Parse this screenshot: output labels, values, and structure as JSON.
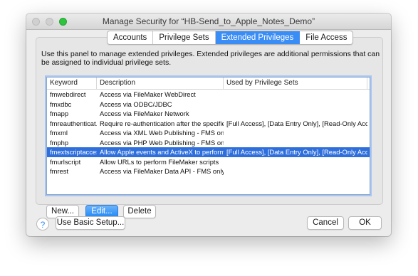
{
  "window": {
    "title": "Manage Security for “HB-Send_to_Apple_Notes_Demo”"
  },
  "tabs": [
    {
      "label": "Accounts",
      "active": false
    },
    {
      "label": "Privilege Sets",
      "active": false
    },
    {
      "label": "Extended Privileges",
      "active": true
    },
    {
      "label": "File Access",
      "active": false
    }
  ],
  "instructions": "Use this panel to manage extended privileges. Extended privileges are additional permissions that can be assigned to individual privilege sets.",
  "table": {
    "headers": [
      "Keyword",
      "Description",
      "Used by Privilege Sets"
    ],
    "rows": [
      {
        "keyword": "fmwebdirect",
        "description": "Access via FileMaker WebDirect",
        "used_by": ""
      },
      {
        "keyword": "fmxdbc",
        "description": "Access via ODBC/JDBC",
        "used_by": ""
      },
      {
        "keyword": "fmapp",
        "description": "Access via FileMaker Network",
        "used_by": ""
      },
      {
        "keyword": "fmreauthenticat...",
        "description": "Require re-authentication after the specified mi...",
        "used_by": "[Full Access], [Data Entry Only], [Read-Only Access]"
      },
      {
        "keyword": "fmxml",
        "description": "Access via XML Web Publishing - FMS only",
        "used_by": ""
      },
      {
        "keyword": "fmphp",
        "description": "Access via PHP Web Publishing - FMS only",
        "used_by": ""
      },
      {
        "keyword": "fmextscriptaccess",
        "description": "Allow Apple events and ActiveX to perform File...",
        "used_by": "[Full Access], [Data Entry Only], [Read-Only Access]",
        "selected": true
      },
      {
        "keyword": "fmurlscript",
        "description": "Allow URLs to perform FileMaker scripts",
        "used_by": ""
      },
      {
        "keyword": "fmrest",
        "description": "Access via FileMaker Data API - FMS only",
        "used_by": ""
      }
    ]
  },
  "buttons": {
    "new": "New...",
    "edit": "Edit...",
    "delete": "Delete",
    "basic_setup": "Use Basic Setup...",
    "cancel": "Cancel",
    "ok": "OK"
  },
  "help_icon": "?",
  "colors": {
    "accent": "#3b8df6",
    "selection": "#2f6fdc",
    "zoom_button": "#2fc440"
  }
}
